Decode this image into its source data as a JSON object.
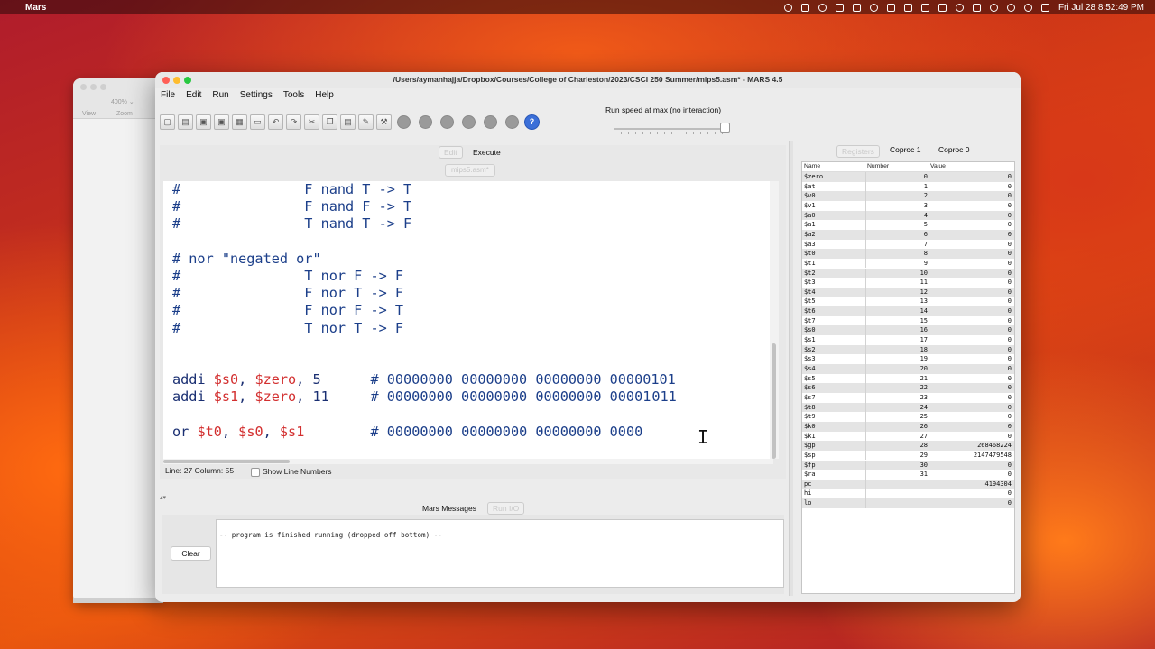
{
  "menubar": {
    "app_name": "Mars",
    "clock": "Fri Jul 28  8:52:49 PM"
  },
  "preview_window": {
    "zoom": "400% ⌄",
    "view_label": "View",
    "zoom_label": "Zoom"
  },
  "window": {
    "title": "/Users/aymanhajja/Dropbox/Courses/College of Charleston/2023/CSCI 250 Summer/mips5.asm* - MARS 4.5",
    "menu": [
      "File",
      "Edit",
      "Run",
      "Settings",
      "Tools",
      "Help"
    ],
    "run_speed": "Run speed at max (no interaction)",
    "run_speed_value": 1.0
  },
  "editor": {
    "tabs": {
      "edit": "Edit",
      "execute": "Execute"
    },
    "file_tab": "mips5.asm*",
    "lines": [
      [
        {
          "t": "#               F nand T -> T",
          "c": "cm"
        }
      ],
      [
        {
          "t": "#               F nand F -> T",
          "c": "cm"
        }
      ],
      [
        {
          "t": "#               T nand T -> F",
          "c": "cm"
        }
      ],
      [],
      [
        {
          "t": "# nor \"negated or\"",
          "c": "cm"
        }
      ],
      [
        {
          "t": "#               T nor F -> F",
          "c": "cm"
        }
      ],
      [
        {
          "t": "#               F nor T -> F",
          "c": "cm"
        }
      ],
      [
        {
          "t": "#               F nor F -> T",
          "c": "cm"
        }
      ],
      [
        {
          "t": "#               T nor T -> F",
          "c": "cm"
        }
      ],
      [],
      [],
      [
        {
          "t": "addi ",
          "c": "kw"
        },
        {
          "t": "$s0",
          "c": "reg"
        },
        {
          "t": ", ",
          "c": "kw"
        },
        {
          "t": "$zero",
          "c": "reg"
        },
        {
          "t": ", 5      ",
          "c": "kw"
        },
        {
          "t": "# 00000000 00000000 00000000 00000101",
          "c": "cm"
        }
      ],
      [
        {
          "t": "addi ",
          "c": "kw"
        },
        {
          "t": "$s1",
          "c": "reg"
        },
        {
          "t": ", ",
          "c": "kw"
        },
        {
          "t": "$zero",
          "c": "reg"
        },
        {
          "t": ", 11     ",
          "c": "kw"
        },
        {
          "t": "# 00000000 00000000 00000000 00001",
          "c": "cm"
        },
        {
          "t": "CARET",
          "c": "caret"
        },
        {
          "t": "011",
          "c": "cm"
        }
      ],
      [],
      [
        {
          "t": "or ",
          "c": "kw"
        },
        {
          "t": "$t0",
          "c": "reg"
        },
        {
          "t": ", ",
          "c": "kw"
        },
        {
          "t": "$s0",
          "c": "reg"
        },
        {
          "t": ", ",
          "c": "kw"
        },
        {
          "t": "$s1",
          "c": "reg"
        },
        {
          "t": "        ",
          "c": "kw"
        },
        {
          "t": "# 00000000 00000000 00000000 0000",
          "c": "cm"
        }
      ]
    ],
    "status": "Line: 27 Column: 55",
    "show_line_numbers": "Show Line Numbers"
  },
  "messages": {
    "tab_messages": "Mars Messages",
    "tab_runio": "Run I/O",
    "clear_label": "Clear",
    "text": "-- program is finished running (dropped off bottom) --"
  },
  "registers": {
    "tabs": [
      "Registers",
      "Coproc 1",
      "Coproc 0"
    ],
    "headers": {
      "name": "Name",
      "number": "Number",
      "value": "Value"
    },
    "rows": [
      [
        "$zero",
        "0",
        "0"
      ],
      [
        "$at",
        "1",
        "0"
      ],
      [
        "$v0",
        "2",
        "0"
      ],
      [
        "$v1",
        "3",
        "0"
      ],
      [
        "$a0",
        "4",
        "0"
      ],
      [
        "$a1",
        "5",
        "0"
      ],
      [
        "$a2",
        "6",
        "0"
      ],
      [
        "$a3",
        "7",
        "0"
      ],
      [
        "$t0",
        "8",
        "0"
      ],
      [
        "$t1",
        "9",
        "0"
      ],
      [
        "$t2",
        "10",
        "0"
      ],
      [
        "$t3",
        "11",
        "0"
      ],
      [
        "$t4",
        "12",
        "0"
      ],
      [
        "$t5",
        "13",
        "0"
      ],
      [
        "$t6",
        "14",
        "0"
      ],
      [
        "$t7",
        "15",
        "0"
      ],
      [
        "$s0",
        "16",
        "0"
      ],
      [
        "$s1",
        "17",
        "0"
      ],
      [
        "$s2",
        "18",
        "0"
      ],
      [
        "$s3",
        "19",
        "0"
      ],
      [
        "$s4",
        "20",
        "0"
      ],
      [
        "$s5",
        "21",
        "0"
      ],
      [
        "$s6",
        "22",
        "0"
      ],
      [
        "$s7",
        "23",
        "0"
      ],
      [
        "$t8",
        "24",
        "0"
      ],
      [
        "$t9",
        "25",
        "0"
      ],
      [
        "$k0",
        "26",
        "0"
      ],
      [
        "$k1",
        "27",
        "0"
      ],
      [
        "$gp",
        "28",
        "268468224"
      ],
      [
        "$sp",
        "29",
        "2147479548"
      ],
      [
        "$fp",
        "30",
        "0"
      ],
      [
        "$ra",
        "31",
        "0"
      ],
      [
        "pc",
        "",
        "4194304"
      ],
      [
        "hi",
        "",
        "0"
      ],
      [
        "lo",
        "",
        "0"
      ]
    ]
  },
  "colors": {
    "register_token": "#d33030",
    "comment": "#1c3f8a",
    "keyword": "#1a2f72"
  }
}
